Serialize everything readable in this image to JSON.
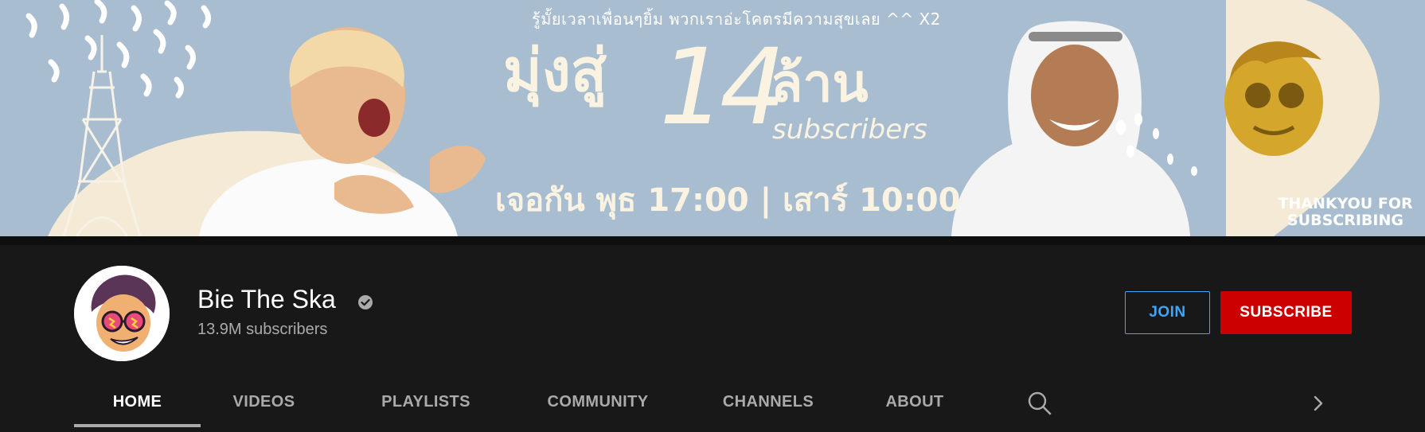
{
  "banner": {
    "top_line": "รู้มั้ยเวลาเพื่อนๆยิ้ม พวกเราอ่ะโคตรมีความสุขเลย ^^  X2",
    "headline_prefix": "มุ่งสู่",
    "headline_number": "14",
    "headline_suffix": "ล้าน",
    "headline_subscribers": "subscribers",
    "schedule": "เจอกัน พุธ 17:00 | เสาร์ 10:00",
    "thanks_line1": "THANKYOU FOR",
    "thanks_line2": "SUBSCRIBING"
  },
  "channel": {
    "name": "Bie The Ska",
    "subscribers": "13.9M subscribers",
    "verified": true
  },
  "actions": {
    "join_label": "JOIN",
    "subscribe_label": "SUBSCRIBE"
  },
  "tabs": [
    {
      "label": "HOME",
      "active": true
    },
    {
      "label": "VIDEOS",
      "active": false
    },
    {
      "label": "PLAYLISTS",
      "active": false
    },
    {
      "label": "COMMUNITY",
      "active": false
    },
    {
      "label": "CHANNELS",
      "active": false
    },
    {
      "label": "ABOUT",
      "active": false
    }
  ],
  "icons": {
    "verified": "check-circle-icon",
    "search": "search-icon",
    "next": "chevron-right-icon"
  },
  "colors": {
    "page_background": "#181818",
    "banner_background": "#a9bdd1",
    "banner_text": "#fbf3e2",
    "join_accent": "#3ea6ff",
    "subscribe_red": "#cc0000",
    "tab_inactive": "#aaaaaa",
    "tab_active": "#ffffff"
  }
}
